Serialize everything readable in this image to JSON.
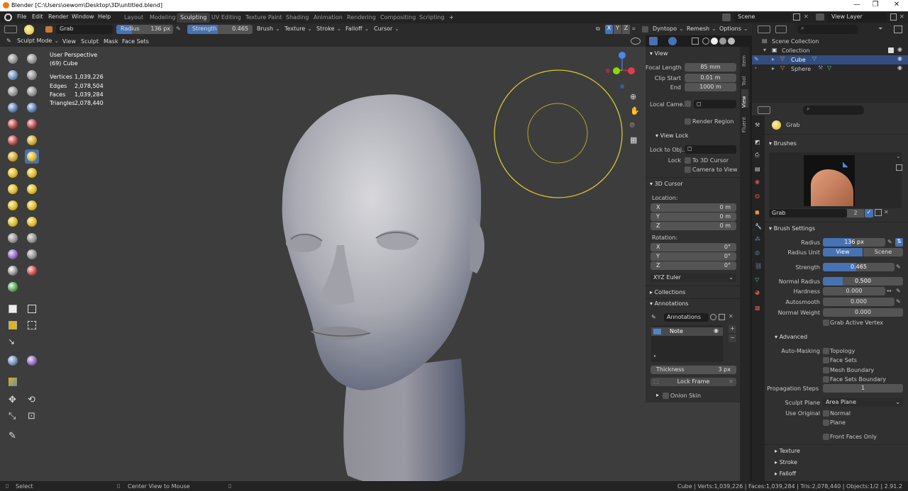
{
  "titlebar": {
    "title": "Blender [C:\\Users\\oewom\\Desktop\\3D\\untitled.blend]",
    "minimize": "—",
    "maximize": "❐",
    "close": "✕"
  },
  "menu": [
    "File",
    "Edit",
    "Render",
    "Window",
    "Help"
  ],
  "workspaces": [
    "Layout",
    "Modeling",
    "Sculpting",
    "UV Editing",
    "Texture Paint",
    "Shading",
    "Animation",
    "Rendering",
    "Compositing",
    "Scripting"
  ],
  "workspace_add": "+",
  "scene": {
    "scene": "Scene",
    "view_layer": "View Layer"
  },
  "toolheader": {
    "brush": "Grab",
    "radius_label": "Radius",
    "radius_value": "136 px",
    "strength_label": "Strength",
    "strength_value": "0.465",
    "menus": [
      "Brush",
      "Texture",
      "Stroke",
      "Falloff",
      "Cursor"
    ],
    "axes": [
      "X",
      "Y",
      "Z"
    ],
    "dyntopo": "Dyntopo",
    "remesh": "Remesh",
    "options": "Options"
  },
  "modeheader": {
    "mode": "Sculpt Mode",
    "menus": [
      "View",
      "Sculpt",
      "Mask",
      "Face Sets"
    ]
  },
  "overlay": {
    "perspective": "User Perspective",
    "object": "(69) Cube",
    "stats": [
      {
        "k": "Vertices",
        "v": "1,039,226"
      },
      {
        "k": "Edges",
        "v": "2,078,504"
      },
      {
        "k": "Faces",
        "v": "1,039,284"
      },
      {
        "k": "Triangles",
        "v": "2,078,440"
      }
    ]
  },
  "npanel": {
    "view_title": "View",
    "focal_label": "Focal Length",
    "focal": "85 mm",
    "clip_start_label": "Clip Start",
    "clip_start": "0.01 m",
    "end_label": "End",
    "end": "1000 m",
    "local_camera": "Local Came...",
    "render_region": "Render Region",
    "view_lock": "View Lock",
    "lock_obj": "Lock to Obj...",
    "lock": "Lock",
    "to_3d_cursor": "To 3D Cursor",
    "camera_to_view": "Camera to View",
    "cursor_title": "3D Cursor",
    "location": "Location:",
    "loc": [
      {
        "a": "X",
        "v": "0 m"
      },
      {
        "a": "Y",
        "v": "0 m"
      },
      {
        "a": "Z",
        "v": "0 m"
      }
    ],
    "rotation": "Rotation:",
    "rot": [
      {
        "a": "X",
        "v": "0°"
      },
      {
        "a": "Y",
        "v": "0°"
      },
      {
        "a": "Z",
        "v": "0°"
      }
    ],
    "euler": "XYZ Euler",
    "collections": "Collections",
    "annotations": "Annotations",
    "annotations_field": "Annotations",
    "note": "Note",
    "thickness_label": "Thickness",
    "thickness": "3 px",
    "lock_frame": "Lock Frame",
    "onion_skin": "Onion Skin"
  },
  "side_tabs": [
    "Item",
    "Tool",
    "View",
    "Fluent"
  ],
  "outliner": {
    "scene_collection": "Scene Collection",
    "collection": "Collection",
    "cube": "Cube",
    "sphere": "Sphere"
  },
  "props": {
    "brush_name": "Grab",
    "brushes": "Brushes",
    "brush_field": "Grab",
    "users": "2",
    "brush_settings": "Brush Settings",
    "radius_label": "Radius",
    "radius": "136 px",
    "radius_unit_label": "Radius Unit",
    "unit_view": "View",
    "unit_scene": "Scene",
    "strength_label": "Strength",
    "strength": "0.465",
    "normal_radius_label": "Normal Radius",
    "normal_radius": "0.500",
    "hardness_label": "Hardness",
    "hardness": "0.000",
    "autosmooth_label": "Autosmooth",
    "autosmooth": "0.000",
    "normal_weight_label": "Normal Weight",
    "normal_weight": "0.000",
    "grab_active": "Grab Active Vertex",
    "advanced": "Advanced",
    "automasking": "Auto-Masking",
    "topology": "Topology",
    "face_sets": "Face Sets",
    "mesh_boundary": "Mesh Boundary",
    "face_sets_boundary": "Face Sets Boundary",
    "prop_steps_label": "Propagation Steps",
    "prop_steps": "1",
    "sculpt_plane_label": "Sculpt Plane",
    "sculpt_plane": "Area Plane",
    "use_original": "Use Original",
    "normal": "Normal",
    "plane": "Plane",
    "front_faces": "Front Faces Only",
    "texture": "Texture",
    "stroke": "Stroke",
    "falloff": "Falloff"
  },
  "status": {
    "select": "Select",
    "center": "Center View to Mouse",
    "right": "Cube | Verts:1,039,226 | Faces:1,039,284 | Tris:2,078,440 | Objects:1/2 | 2.91.2"
  },
  "colors": {
    "accent": "#4772b3",
    "brush_circle": "#d9c532",
    "selected_row": "#334d80"
  },
  "fills": {
    "radius_fraction": 0.45,
    "strength_fraction": 0.465,
    "normal_radius_fraction": 0.25
  }
}
